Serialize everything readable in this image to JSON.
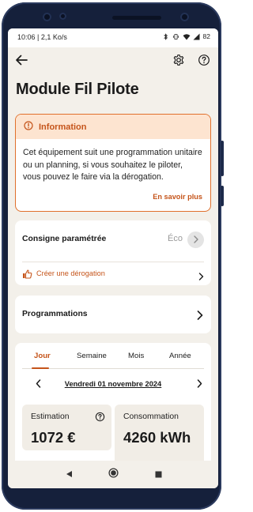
{
  "status_bar": {
    "time": "10:06 | 2,1 Ko/s",
    "battery": "82"
  },
  "app_bar": {
    "back_icon": "arrow-left-icon",
    "settings_icon": "gear-icon",
    "help_icon": "question-circle-icon"
  },
  "page": {
    "title": "Module Fil Pilote"
  },
  "info": {
    "title": "Information",
    "text": "Cet équipement suit une programmation unitaire ou un planning, si vous souhaitez le piloter, vous pouvez le faire via la dérogation.",
    "link": "En savoir plus"
  },
  "consigne": {
    "label": "Consigne paramétrée",
    "value": "Éco",
    "derogation_label": "Créer une dérogation"
  },
  "programmations": {
    "label": "Programmations"
  },
  "stats": {
    "tabs": [
      "Jour",
      "Semaine",
      "Mois",
      "Année"
    ],
    "active_tab": "Jour",
    "date": "Vendredi 01 novembre 2024",
    "estimation_label": "Estimation",
    "estimation_value": "1072 €",
    "consommation_label": "Consommation",
    "consommation_value": "4260 kWh"
  },
  "colors": {
    "accent": "#c5541a",
    "info_border": "#e0702c",
    "info_bg": "#fde4d0",
    "screen_bg": "#f3f0ea"
  }
}
